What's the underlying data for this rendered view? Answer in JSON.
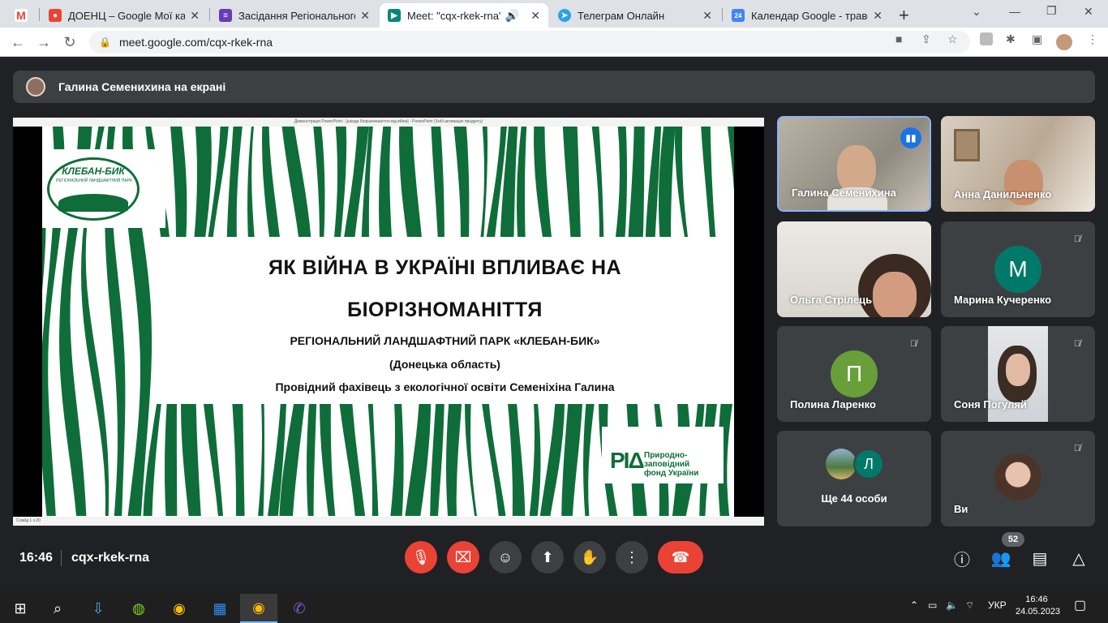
{
  "browser": {
    "tabs": [
      {
        "title": "",
        "icon": "gmail-icon",
        "color": "#ea4335",
        "glyph": "M"
      },
      {
        "title": "ДОЕНЦ – Google Мої карти",
        "icon": "maps-icon",
        "color": "#ea4335",
        "glyph": "⬤"
      },
      {
        "title": "Засідання Регіонального с",
        "icon": "forms-icon",
        "color": "#673ab7",
        "glyph": "≡"
      },
      {
        "title": "Meet: \"cqx-rkek-rna\"",
        "icon": "meet-icon",
        "color": "#00897b",
        "glyph": "▶"
      },
      {
        "title": "Телеграм Онлайн",
        "icon": "telegram-icon",
        "color": "#2aa3e0",
        "glyph": "➤"
      },
      {
        "title": "Календар Google - травен",
        "icon": "calendar-icon",
        "color": "#4285f4",
        "glyph": "24"
      }
    ],
    "new_tab": "+",
    "url": "meet.google.com/cqx-rkek-rna"
  },
  "meet": {
    "banner": "Галина Семенихина на екрані",
    "presentation": {
      "window_title": "Демонстрація PowerPoint - [шкода біорізноманіттю від війни] - PowerPoint (Хибі активацію продукту)",
      "status": "Слайд 1 з 20",
      "logo_title": "КЛЕБАН-БИК",
      "logo_subtitle": "РЕГІОНАЛЬНИЙ ЛАНДШАФТНИЙ ПАРК",
      "title_line1": "ЯК ВІЙНА В УКРАЇНІ ВПЛИВАЄ НА",
      "title_line2": "БІОРІЗНОМАНІТТЯ",
      "subtitle1": "РЕГІОНАЛЬНИЙ ЛАНДШАФТНИЙ ПАРК «КЛЕБАН-БИК»",
      "subtitle2": "(Донецька область)",
      "subtitle3": "Провідний фахівець з екологічної освіти Семеніхіна Галина",
      "pzf_line1": "Природно-",
      "pzf_line2": "заповідний",
      "pzf_line3": "фонд України"
    },
    "participants": [
      {
        "name": "Галина Семенихина",
        "type": "video",
        "speaking": true
      },
      {
        "name": "Анна Данильченко",
        "type": "video"
      },
      {
        "name": "Ольга Стрілець",
        "type": "video"
      },
      {
        "name": "Марина Кучеренко",
        "type": "letter",
        "letter": "М",
        "color": "#00796b",
        "muted": true
      },
      {
        "name": "Полина Ларенко",
        "type": "letter",
        "letter": "П",
        "color": "#689f38",
        "muted": true
      },
      {
        "name": "Соня Погуляй",
        "type": "video",
        "muted": true
      },
      {
        "name": "Ще 44 особи",
        "type": "more",
        "letter": "Л",
        "color": "#00796b"
      },
      {
        "name": "Ви",
        "type": "video",
        "muted": true
      }
    ],
    "time": "16:46",
    "code": "cqx-rkek-rna",
    "people_count": "52"
  },
  "taskbar": {
    "lang": "УКР",
    "time": "16:46",
    "date": "24.05.2023"
  }
}
